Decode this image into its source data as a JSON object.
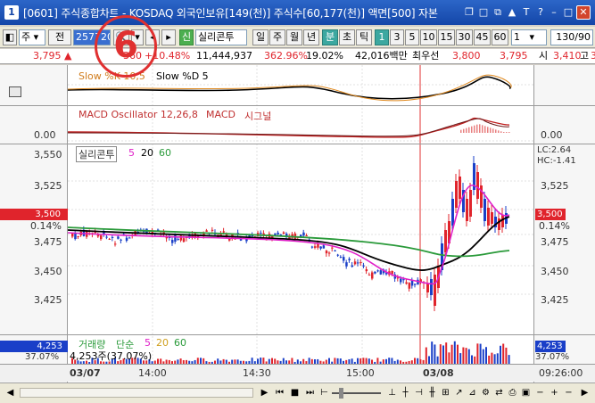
{
  "titlebar": {
    "number": "1",
    "title": "[0601] 주식종합차트 - KOSDAQ 외국인보유[149(천)] 주식수[60,177(천)] 액면[500] 자본",
    "buttons": [
      "❐",
      "□",
      "⧉",
      "▲",
      "T",
      "?",
      "–",
      "□",
      "✕"
    ]
  },
  "toolbar": {
    "mode_box": "주",
    "all_label": "전",
    "code_value": "257720",
    "stock_name": "실리콘투",
    "sin_badge": "신",
    "periods": [
      "일",
      "주",
      "월",
      "년",
      "분",
      "초",
      "틱"
    ],
    "selected_period": "분",
    "minutes": [
      "1",
      "3",
      "5",
      "10",
      "15",
      "30",
      "45",
      "60"
    ],
    "selected_minute": "1",
    "interval_select": "1",
    "count_box": "130/90"
  },
  "quote": {
    "price": "3,795",
    "change_arrow": "▲",
    "change": "360",
    "change_pct": "+10.48%",
    "volume": "11,444,937",
    "volume_ratio": "362.96%",
    "turnover": "19.02%",
    "amount": "42,016백만",
    "best_ask_label": "최우선",
    "best_ask": "3,800",
    "best_bid": "3,795",
    "open_label": "시",
    "open": "3,410",
    "high_label": "고",
    "high": "3"
  },
  "stochastic": {
    "label_k": "Slow %K 10,5",
    "label_d": "Slow %D 5"
  },
  "macd": {
    "label_osc": "MACD Oscillator 12,26,8",
    "label_macd": "MACD",
    "label_signal": "시그널",
    "zero_label": "0.00",
    "zero_label_right": "0.00"
  },
  "price_pane": {
    "legend_name": "실리콘투",
    "legend_ma": [
      "5",
      "20",
      "60"
    ],
    "y_ticks": [
      "3,550",
      "3,525",
      "3,500",
      "3,475",
      "3,450",
      "3,425"
    ],
    "current_tag": "3,500",
    "current_pct": "0.14%",
    "lc": "LC:2.64",
    "hc": "HC:-1.41",
    "right_ticks": [
      "3,525",
      "3,475",
      "3,450",
      "3,425"
    ],
    "right_tag": "3,500",
    "right_pct": "0.14%"
  },
  "volume_pane": {
    "label": "거래량",
    "unit": "단순",
    "ma": [
      "5",
      "20",
      "60"
    ],
    "left_tag": "4,253",
    "left_pct": "37.07%",
    "info": "4,253주(37.07%)",
    "right_tag": "4,253",
    "right_pct": "37.07%"
  },
  "xaxis": {
    "labels": [
      "03/07",
      "14:00",
      "14:30",
      "15:00",
      "03/08"
    ],
    "right_time": "09:26:00"
  },
  "annotation": {
    "circled_number": "6"
  },
  "colors": {
    "up": "#e0242c",
    "down": "#1a3fc8",
    "ma5": "#e020c8",
    "ma20": "#000000",
    "ma60": "#2a9a3a",
    "title_bg": "#1446a8"
  }
}
